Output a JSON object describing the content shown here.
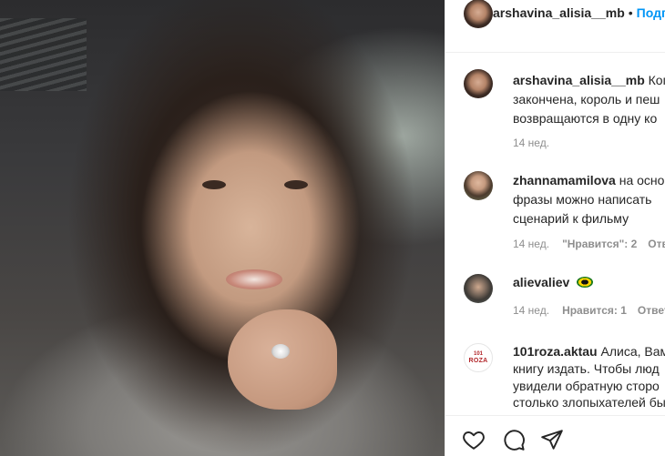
{
  "header": {
    "username": "arshavina_alisia__mb",
    "separator": "•",
    "follow_label": "Подп"
  },
  "comments": [
    {
      "username": "arshavina_alisia__mb",
      "lines": [
        "Когд",
        "закончена, король и пеш",
        "возвращаются в одну ко"
      ],
      "time": "14 нед."
    },
    {
      "username": "zhannamamilova",
      "lines": [
        "на осно",
        "фразы можно написать",
        "сценарий к фильму"
      ],
      "time": "14 нед.",
      "likes": "\"Нравится\": 2",
      "reply": "Отв"
    },
    {
      "username": "alievaliev",
      "lines": [
        ""
      ],
      "emoji": "sunglasses-emoji",
      "time": "14 нед.",
      "likes": "Нравится: 1",
      "reply": "Ответ"
    },
    {
      "username": "101roza.aktau",
      "lines": [
        "Алиса, Вам",
        "книгу издать. Чтобы люд",
        "увидели обратную сторо",
        "столько злопыхателей бы"
      ],
      "avatar_text": [
        "101",
        "ROZA"
      ]
    }
  ],
  "actions": {
    "icons": [
      "heart-icon",
      "comment-icon",
      "share-icon"
    ]
  },
  "colors": {
    "follow": "#0095f6",
    "meta": "#8e8e8e",
    "text": "#262626",
    "roza_brand": "#b2262a"
  }
}
